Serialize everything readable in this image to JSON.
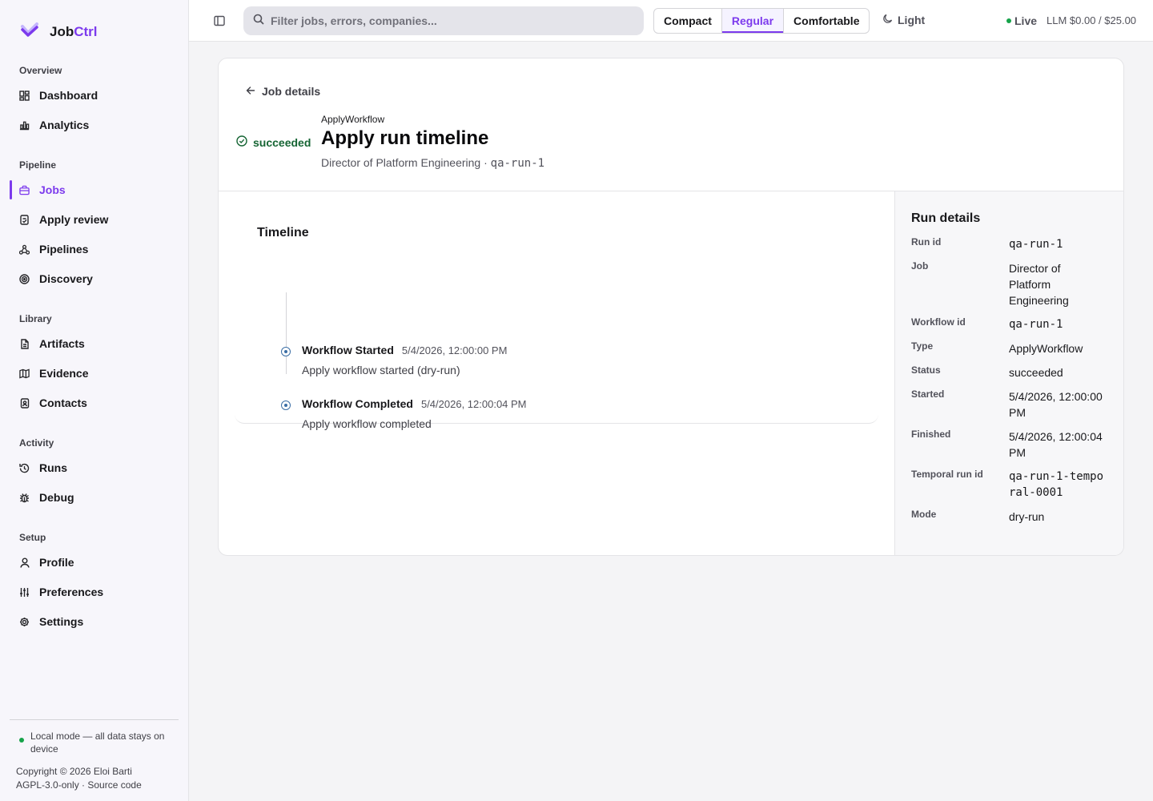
{
  "brand": {
    "name_part1": "Job",
    "name_part2": "Ctrl"
  },
  "sidebar": {
    "sections": [
      {
        "title": "Overview",
        "items": [
          {
            "label": "Dashboard",
            "icon": "dashboard-icon"
          },
          {
            "label": "Analytics",
            "icon": "bar-chart-icon"
          }
        ]
      },
      {
        "title": "Pipeline",
        "items": [
          {
            "label": "Jobs",
            "icon": "briefcase-icon",
            "active": true
          },
          {
            "label": "Apply review",
            "icon": "clipboard-check-icon"
          },
          {
            "label": "Pipelines",
            "icon": "workflow-icon"
          },
          {
            "label": "Discovery",
            "icon": "radar-icon"
          }
        ]
      },
      {
        "title": "Library",
        "items": [
          {
            "label": "Artifacts",
            "icon": "document-icon"
          },
          {
            "label": "Evidence",
            "icon": "map-icon"
          },
          {
            "label": "Contacts",
            "icon": "address-book-icon"
          }
        ]
      },
      {
        "title": "Activity",
        "items": [
          {
            "label": "Runs",
            "icon": "history-icon"
          },
          {
            "label": "Debug",
            "icon": "bug-icon"
          }
        ]
      },
      {
        "title": "Setup",
        "items": [
          {
            "label": "Profile",
            "icon": "user-icon"
          },
          {
            "label": "Preferences",
            "icon": "sliders-icon"
          },
          {
            "label": "Settings",
            "icon": "gear-icon"
          }
        ]
      }
    ],
    "footer": {
      "local_mode": "Local mode — all data stays on device",
      "copyright": "Copyright © 2026 Eloi Barti",
      "license": "AGPL-3.0-only · Source code"
    }
  },
  "topbar": {
    "search_placeholder": "Filter jobs, errors, companies...",
    "density": {
      "options": [
        "Compact",
        "Regular",
        "Comfortable"
      ],
      "selected": "Regular"
    },
    "theme_label": "Light",
    "live_label": "Live",
    "llm_usage": "LLM $0.00 / $25.00"
  },
  "page": {
    "back_label": "Job details",
    "status": "succeeded",
    "eyebrow": "ApplyWorkflow",
    "title": "Apply run timeline",
    "subtitle_job": "Director of Platform Engineering · ",
    "subtitle_run": "qa-run-1"
  },
  "timeline": {
    "title": "Timeline",
    "events": [
      {
        "name": "Workflow Started",
        "time": "5/4/2026, 12:00:00 PM",
        "description": "Apply workflow started (dry-run)"
      },
      {
        "name": "Workflow Completed",
        "time": "5/4/2026, 12:00:04 PM",
        "description": "Apply workflow completed"
      }
    ]
  },
  "run_details": {
    "title": "Run details",
    "rows": [
      {
        "label": "Run id",
        "value": "qa-run-1",
        "mono": true
      },
      {
        "label": "Job",
        "value": "Director of Platform Engineering"
      },
      {
        "label": "Workflow id",
        "value": "qa-run-1",
        "mono": true
      },
      {
        "label": "Type",
        "value": "ApplyWorkflow"
      },
      {
        "label": "Status",
        "value": "succeeded"
      },
      {
        "label": "Started",
        "value": "5/4/2026, 12:00:00 PM"
      },
      {
        "label": "Finished",
        "value": "5/4/2026, 12:00:04 PM"
      },
      {
        "label": "Temporal run id",
        "value": "qa-run-1-temporal-0001",
        "mono": true
      },
      {
        "label": "Mode",
        "value": "dry-run"
      }
    ]
  }
}
